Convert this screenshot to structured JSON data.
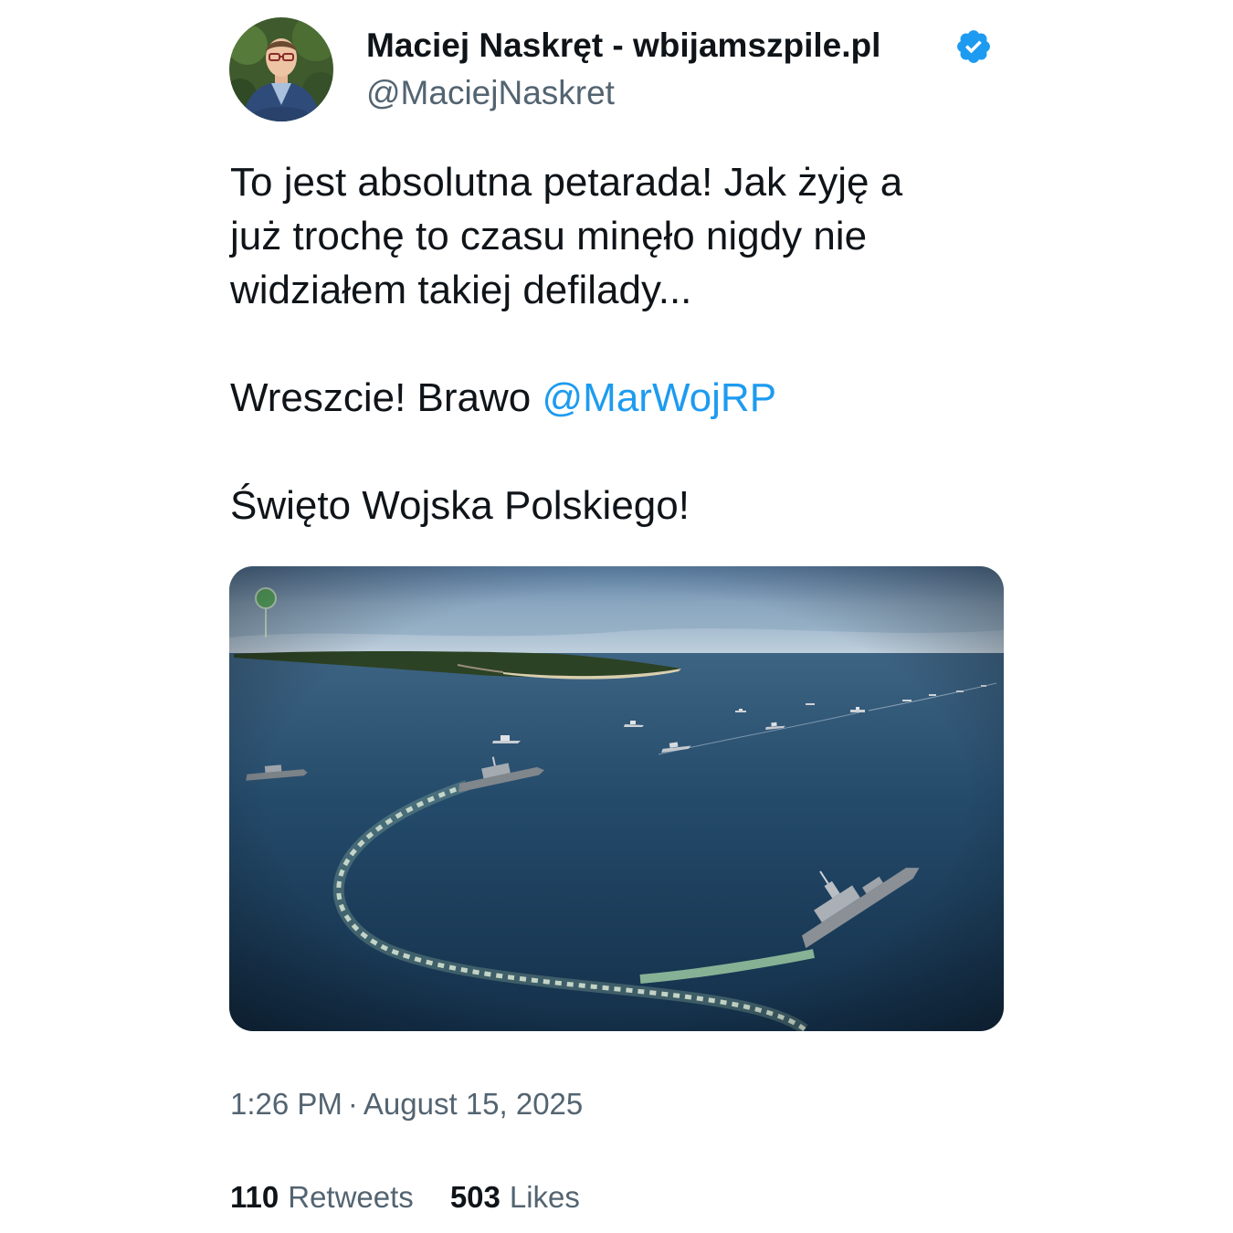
{
  "author": {
    "display_name": "Maciej Naskręt - wbijamszpile.pl",
    "handle": "@MaciejNaskret",
    "verified": true,
    "avatar_icon": "profile-photo-avatar",
    "verified_icon": "verified-badge-icon"
  },
  "tweet": {
    "lines": [
      "To jest absolutna petarada! Jak żyję a",
      "już trochę to czasu minęło nigdy nie",
      "widziałem takiej defilady..."
    ],
    "line2_prefix": "Wreszcie! Brawo ",
    "mention": "@MarWojRP",
    "line3": "Święto Wojska Polskiego!"
  },
  "media": {
    "icon": "naval-parade-photo"
  },
  "timestamp": {
    "time": "1:26 PM",
    "separator": "·",
    "date": "August 15, 2025"
  },
  "stats": {
    "retweets_count": "110",
    "retweets_label": "Retweets",
    "likes_count": "503",
    "likes_label": "Likes"
  },
  "colors": {
    "text": "#0f1419",
    "secondary": "#536471",
    "accent": "#1d9bf0"
  }
}
